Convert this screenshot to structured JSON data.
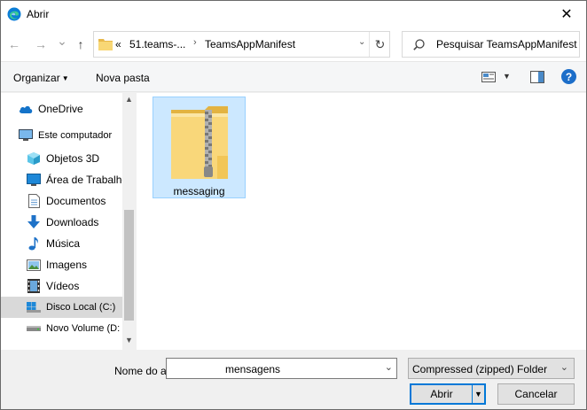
{
  "window": {
    "title": "Abrir",
    "close_glyph": "✕"
  },
  "navigation": {
    "back_glyph": "←",
    "forward_glyph": "→",
    "recent_glyph": "⌄",
    "up_glyph": "↑",
    "overflow": "«",
    "crumbs": [
      "51.teams-...",
      "TeamsAppManifest"
    ],
    "separator": "›",
    "refresh_glyph": "↻",
    "dropdown_glyph": "⌄"
  },
  "search": {
    "placeholder": "Pesquisar TeamsAppManifest"
  },
  "toolbar": {
    "organize_label": "Organizar",
    "new_folder_label": "Nova pasta",
    "help_label": "?"
  },
  "sidebar": {
    "items": [
      {
        "label": "OneDrive",
        "icon": "cloud-icon"
      },
      {
        "label": "Este computador",
        "icon": "computer-icon"
      },
      {
        "label": "Objetos 3D",
        "icon": "cube-icon"
      },
      {
        "label": "Área de Trabalho",
        "icon": "desktop-icon"
      },
      {
        "label": "Documentos",
        "icon": "document-icon"
      },
      {
        "label": "Downloads",
        "icon": "download-icon"
      },
      {
        "label": "Música",
        "icon": "music-icon"
      },
      {
        "label": "Imagens",
        "icon": "image-icon"
      },
      {
        "label": "Vídeos",
        "icon": "video-icon"
      },
      {
        "label": "Disco Local (C:)",
        "icon": "drive-icon",
        "selected": true
      },
      {
        "label": "Novo Volume (D:",
        "icon": "drive-icon"
      }
    ],
    "scroll_up": "▲",
    "scroll_down": "▼"
  },
  "files": [
    {
      "name": "messaging",
      "type": "zip-folder",
      "selected": true
    }
  ],
  "footer": {
    "filename_label": "Nome do arquivo:",
    "filename_value": "mensagens",
    "filetype_value": "Compressed (zipped) Folder",
    "open_label": "Abrir",
    "cancel_label": "Cancelar",
    "caret": "⌄",
    "split_caret": "▼"
  },
  "colors": {
    "accent": "#0078d7",
    "selection": "#cce8ff",
    "help": "#1c6ec9"
  }
}
